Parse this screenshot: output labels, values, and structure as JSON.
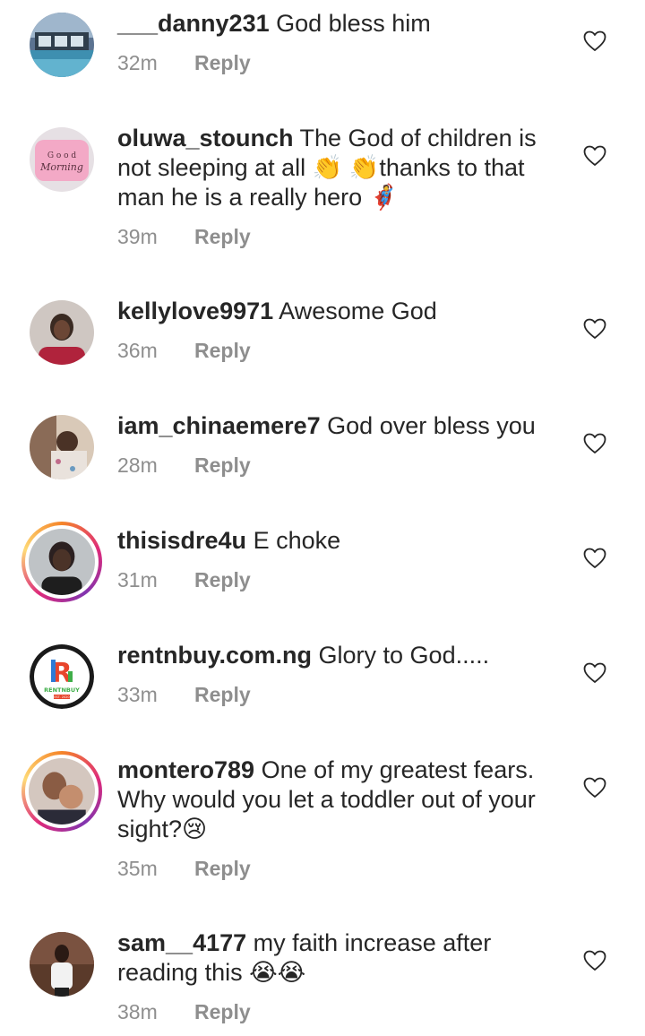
{
  "comments": [
    {
      "username": "___danny231",
      "text": "God bless him",
      "time": "32m",
      "reply": "Reply"
    },
    {
      "username": "oluwa_stounch",
      "text": "The God of children is not sleeping at all 👏 👏thanks to that man he is a really hero 🦸",
      "time": "39m",
      "reply": "Reply"
    },
    {
      "username": "kellylove9971",
      "text": "Awesome God",
      "time": "36m",
      "reply": "Reply"
    },
    {
      "username": "iam_chinaemere7",
      "text": "God over bless you",
      "time": "28m",
      "reply": "Reply"
    },
    {
      "username": "thisisdre4u",
      "text": "E choke",
      "time": "31m",
      "reply": "Reply"
    },
    {
      "username": "rentnbuy.com.ng",
      "text": "Glory to God.....",
      "time": "33m",
      "reply": "Reply"
    },
    {
      "username": "montero789",
      "text": "One of my greatest fears. Why would you let a toddler out of your sight?😢",
      "time": "35m",
      "reply": "Reply"
    },
    {
      "username": "sam__4177",
      "text": "my faith increase after reading this 😭😭",
      "time": "38m",
      "reply": "Reply"
    }
  ],
  "avatar_logo_text": {
    "letter": "R",
    "brand": "RENTNBUY",
    "est": "EST. 2020"
  },
  "avatar_pillow_text": {
    "line1": "G o o d",
    "line2": "Morning"
  },
  "colors": {
    "text": "#262626",
    "meta": "#8e8e8e",
    "story_ring": [
      "#f58529",
      "#dd2a7b",
      "#8134af",
      "#feda77"
    ]
  },
  "icons": {
    "like": "heart-outline-icon"
  }
}
